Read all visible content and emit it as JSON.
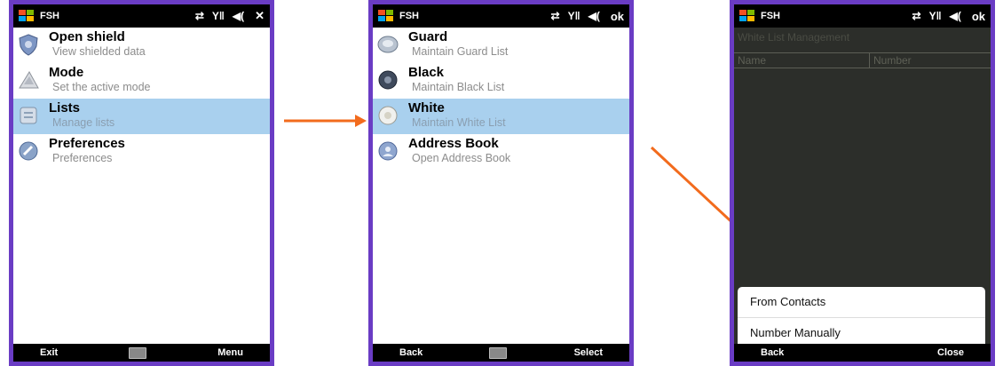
{
  "screens": [
    {
      "status": {
        "app_title": "FSH",
        "action": "✕"
      },
      "items": [
        {
          "title": "Open shield",
          "subtitle": "View shielded data"
        },
        {
          "title": "Mode",
          "subtitle": "Set the active mode"
        },
        {
          "title": "Lists",
          "subtitle": "Manage lists"
        },
        {
          "title": "Preferences",
          "subtitle": "Preferences"
        }
      ],
      "selected_index": 2,
      "softkeys": {
        "left": "Exit",
        "right": "Menu"
      }
    },
    {
      "status": {
        "app_title": "FSH",
        "action": "ok"
      },
      "items": [
        {
          "title": "Guard",
          "subtitle": "Maintain Guard List"
        },
        {
          "title": "Black",
          "subtitle": "Maintain Black List"
        },
        {
          "title": "White",
          "subtitle": "Maintain White List"
        },
        {
          "title": "Address Book",
          "subtitle": "Open Address Book"
        }
      ],
      "selected_index": 2,
      "softkeys": {
        "left": "Back",
        "right": "Select"
      }
    },
    {
      "status": {
        "app_title": "FSH",
        "action": "ok"
      },
      "page_title": "White List Management",
      "columns": [
        "Name",
        "Number"
      ],
      "popup_options": [
        "From Contacts",
        "Number Manually"
      ],
      "softkeys": {
        "left": "Back",
        "right": "Close"
      }
    }
  ],
  "colors": {
    "frame": "#6a3cc4",
    "selection": "#a9d0ee",
    "arrow": "#f26b1d",
    "dark_screen": "#2c2e2a"
  }
}
